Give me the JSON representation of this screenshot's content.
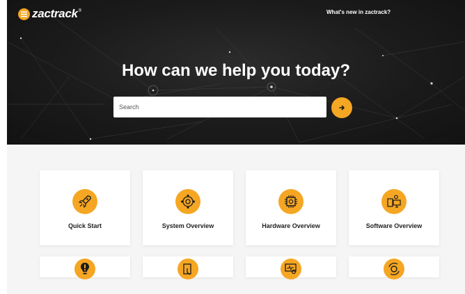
{
  "header": {
    "brand": "zactrack",
    "trademark": "®",
    "whats_new_link": "What's new in zactrack?"
  },
  "hero": {
    "headline": "How can we help you today?",
    "search_placeholder": "Search",
    "search_button_icon": "arrow-right-icon"
  },
  "colors": {
    "accent": "#f5a623",
    "hero_bg": "#1b1b1b",
    "content_bg": "#f5f5f5"
  },
  "categories": [
    {
      "label": "Quick Start",
      "icon": "rocket-icon"
    },
    {
      "label": "System Overview",
      "icon": "system-network-icon"
    },
    {
      "label": "Hardware Overview",
      "icon": "chip-icon"
    },
    {
      "label": "Software Overview",
      "icon": "computer-gear-icon"
    }
  ],
  "categories_row2": [
    {
      "label": "",
      "icon": "lightbulb-exclamation-icon"
    },
    {
      "label": "",
      "icon": "tablet-touch-icon"
    },
    {
      "label": "",
      "icon": "monitor-search-icon"
    },
    {
      "label": "",
      "icon": "gear-cycle-icon"
    }
  ]
}
